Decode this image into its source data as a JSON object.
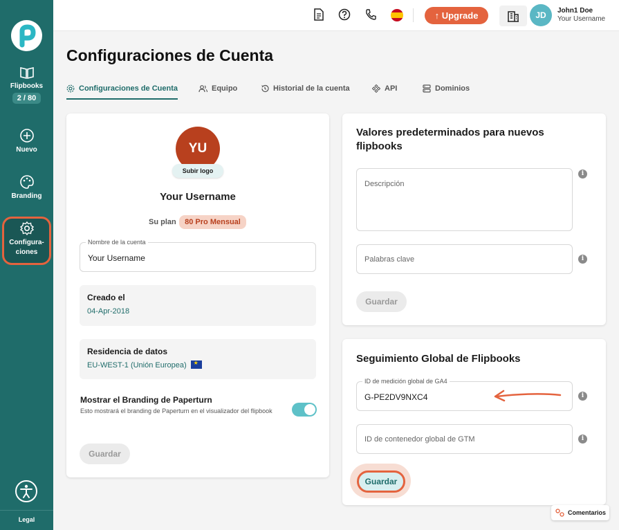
{
  "sidebar": {
    "flipbooks_label": "Flipbooks",
    "flipbooks_count": "2 / 80",
    "new_label": "Nuevo",
    "branding_label": "Branding",
    "settings_label_1": "Configura-",
    "settings_label_2": "ciones",
    "legal_label": "Legal"
  },
  "topbar": {
    "upgrade_label": "Upgrade",
    "avatar_initials": "JD",
    "user_name": "John1 Doe",
    "user_sub": "Your Username"
  },
  "page": {
    "title": "Configuraciones de Cuenta"
  },
  "tabs": [
    {
      "label": "Configuraciones de Cuenta",
      "icon": "gear-icon",
      "active": true
    },
    {
      "label": "Equipo",
      "icon": "users-icon",
      "active": false
    },
    {
      "label": "Historial de la cuenta",
      "icon": "history-icon",
      "active": false
    },
    {
      "label": "API",
      "icon": "api-icon",
      "active": false
    },
    {
      "label": "Dominios",
      "icon": "server-icon",
      "active": false
    }
  ],
  "account": {
    "logo_initials": "YU",
    "upload_logo_label": "Subir logo",
    "username": "Your Username",
    "plan_label": "Su plan",
    "plan_value": "80 Pro Mensual",
    "account_name_label": "Nombre de la cuenta",
    "account_name_value": "Your Username",
    "created_label": "Creado el",
    "created_value": "04-Apr-2018",
    "residency_label": "Residencia de datos",
    "residency_value": "EU-WEST-1 (Unión Europea)",
    "branding_title": "Mostrar el Branding de Paperturn",
    "branding_desc": "Esto mostrará el branding de Paperturn en el visualizador del flipbook",
    "branding_enabled": true,
    "save_label": "Guardar"
  },
  "defaults": {
    "title": "Valores predeterminados para nuevos flipbooks",
    "description_placeholder": "Descripción",
    "keywords_placeholder": "Palabras clave",
    "save_label": "Guardar"
  },
  "tracking": {
    "title": "Seguimiento Global de Flipbooks",
    "ga4_label": "ID de medición global de GA4",
    "ga4_value": "G-PE2DV9NXC4",
    "gtm_placeholder": "ID de contenedor global de GTM",
    "save_label": "Guardar"
  },
  "feedback": {
    "label": "Comentarios"
  },
  "colors": {
    "sidebar": "#1f6c6a",
    "accent": "#e4633e",
    "toggle": "#5ec1c8",
    "logo_bg": "#b8401e"
  }
}
